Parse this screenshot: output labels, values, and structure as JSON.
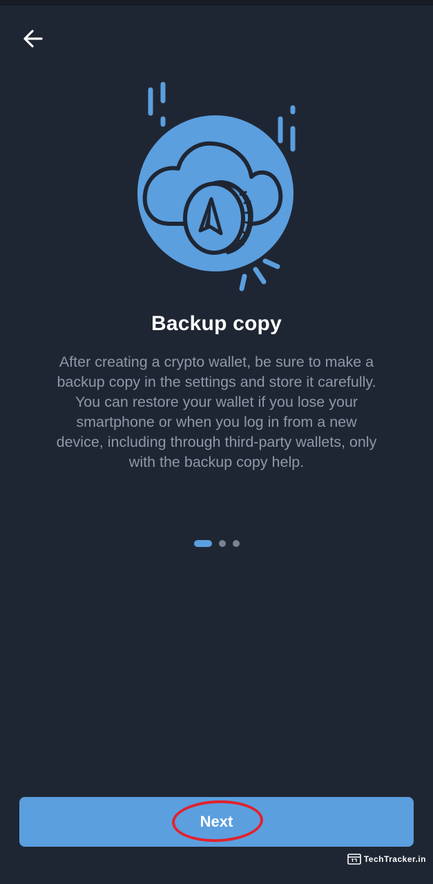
{
  "header": {
    "back_icon": "arrow-left-icon"
  },
  "illustration": {
    "icon": "cloud-coin-icon",
    "accent_color": "#5b9fdf"
  },
  "content": {
    "title": "Backup copy",
    "description": "After creating a crypto wallet, be sure to make a backup copy in the settings and store it carefully. You can restore your wallet if you lose your smartphone or when you log in from a new device, including through third-party wallets, only with the backup copy help."
  },
  "pager": {
    "total_pages": 3,
    "current_page": 1
  },
  "footer": {
    "next_label": "Next",
    "highlight_color": "#e0232e"
  },
  "watermark": {
    "text": "TechTracker.in"
  },
  "colors": {
    "background": "#1f2633",
    "accent": "#5b9fdf",
    "text_primary": "#ffffff",
    "text_secondary": "#8f98a6"
  }
}
